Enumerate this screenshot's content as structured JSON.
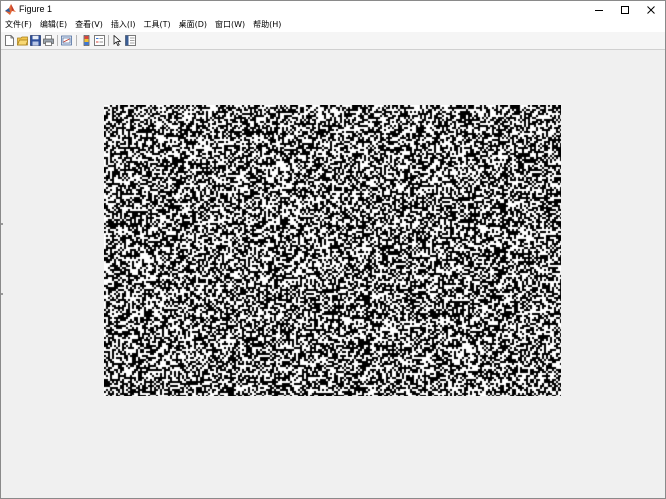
{
  "window": {
    "title": "Figure 1",
    "icon": "matlab-logo-icon",
    "controls": [
      "minimize-icon",
      "maximize-icon",
      "close-icon"
    ]
  },
  "menu": {
    "items": [
      {
        "label": "文件(F)"
      },
      {
        "label": "编辑(E)"
      },
      {
        "label": "查看(V)"
      },
      {
        "label": "插入(I)"
      },
      {
        "label": "工具(T)"
      },
      {
        "label": "桌面(D)"
      },
      {
        "label": "窗口(W)"
      },
      {
        "label": "帮助(H)"
      }
    ]
  },
  "toolbar": {
    "buttons": [
      "new-figure-icon",
      "open-file-icon",
      "save-icon",
      "print-icon",
      "link-plot-icon",
      "colorbar-icon",
      "legend-icon",
      "select-arrow-icon",
      "property-editor-icon"
    ]
  },
  "figure": {
    "content": "random binary noise image",
    "colormap": [
      "#000000",
      "#ffffff"
    ],
    "background": "#f0f0f0"
  }
}
